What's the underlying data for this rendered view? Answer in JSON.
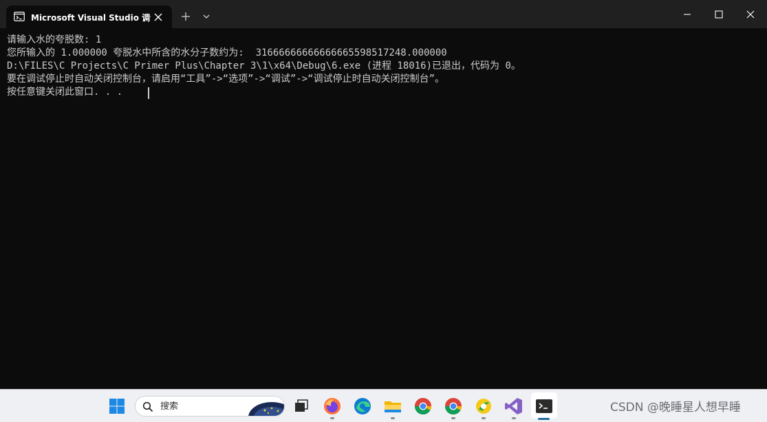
{
  "window": {
    "tab_title": "Microsoft Visual Studio 调试控制台",
    "icons": {
      "tab": "terminal-icon",
      "close_tab": "close-icon",
      "new_tab": "plus-icon",
      "dropdown": "chevron-down-icon",
      "minimize": "minimize-icon",
      "maximize": "maximize-icon",
      "close": "close-icon"
    }
  },
  "console": {
    "lines": [
      "请输入水的夸脱数: 1",
      "您所输入的 1.000000 夸脱水中所含的水分子数约为:  31666666666666665598517248.000000",
      "D:\\FILES\\C Projects\\C Primer Plus\\Chapter 3\\1\\x64\\Debug\\6.exe (进程 18016)已退出，代码为 0。",
      "要在调试停止时自动关闭控制台，请启用“工具”->“选项”->“调试”->“调试停止时自动关闭控制台”。",
      "按任意键关闭此窗口. . ."
    ]
  },
  "taskbar": {
    "search_placeholder": "搜索",
    "apps": [
      "windows-start-icon",
      "task-view-icon",
      "firefox-icon",
      "edge-icon",
      "file-explorer-icon",
      "chrome-icon",
      "chrome-icon",
      "qq-browser-icon",
      "visual-studio-icon",
      "terminal-icon"
    ],
    "watermark": "CSDN @晚睡星人想早睡"
  },
  "colors": {
    "console_bg": "#0c0c0c",
    "console_text": "#cccccc",
    "titlebar_bg": "#202020",
    "taskbar_bg": "#eef0f3"
  }
}
